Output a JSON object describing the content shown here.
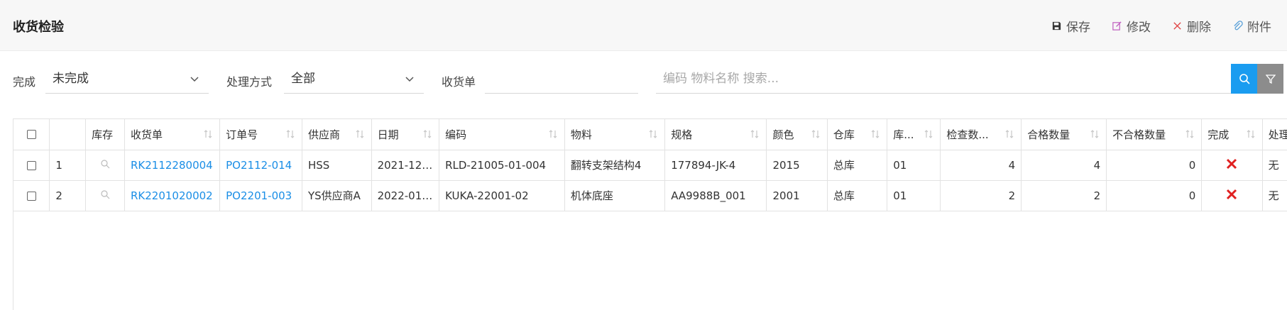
{
  "header": {
    "title": "收货检验",
    "actions": [
      {
        "label": "保存",
        "icon": "save-icon"
      },
      {
        "label": "修改",
        "icon": "edit-icon"
      },
      {
        "label": "删除",
        "icon": "close-icon"
      },
      {
        "label": "附件",
        "icon": "paperclip-icon"
      }
    ]
  },
  "filters": {
    "done_label": "完成",
    "done_value": "未完成",
    "method_label": "处理方式",
    "method_value": "全部",
    "receipt_label": "收货单",
    "receipt_value": "",
    "search_placeholder": "编码 物料名称 搜索..."
  },
  "table": {
    "columns": [
      "",
      "",
      "库存",
      "收货单",
      "订单号",
      "供应商",
      "日期",
      "编码",
      "物料",
      "规格",
      "颜色",
      "仓库",
      "库...",
      "检查数...",
      "合格数量",
      "不合格数量",
      "完成",
      "处理方"
    ],
    "rows": [
      {
        "index": "1",
        "receipt": "RK2112280004",
        "order": "PO2112-014",
        "supplier": "HSS",
        "date": "2021-12-...",
        "code": "RLD-21005-01-004",
        "material": "翻转支架结构4",
        "spec": "177894-JK-4",
        "color": "2015",
        "warehouse": "总库",
        "location": "01",
        "checked": "4",
        "passed": "4",
        "failed": "0",
        "method": "无"
      },
      {
        "index": "2",
        "receipt": "RK2201020002",
        "order": "PO2201-003",
        "supplier": "YS供应商A",
        "date": "2022-01-...",
        "code": "KUKA-22001-02",
        "material": "机体底座",
        "spec": "AA9988B_001",
        "color": "2001",
        "warehouse": "总库",
        "location": "01",
        "checked": "2",
        "passed": "2",
        "failed": "0",
        "method": "无"
      }
    ]
  },
  "colors": {
    "accent": "#1a9cf0",
    "link": "#1a8ee6",
    "danger": "#e02020"
  }
}
